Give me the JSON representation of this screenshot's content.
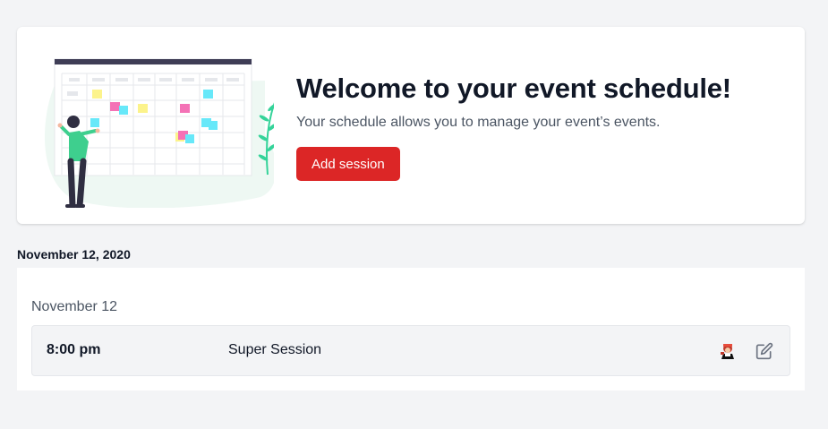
{
  "hero": {
    "title": "Welcome to your event schedule!",
    "subtitle": "Your schedule allows you to manage your event’s events.",
    "add_session_label": "Add session",
    "illustration_icon": "calendar-illustration"
  },
  "schedule": {
    "date_heading": "November 12, 2020",
    "days": [
      {
        "label": "November 12",
        "sessions": [
          {
            "time": "8:00 pm",
            "name": "Super Session",
            "speaker_icon": "speaker-avatar-icon",
            "action_icon": "edit-icon"
          }
        ]
      }
    ]
  },
  "colors": {
    "accent": "#dc2626",
    "background": "#f3f4f6",
    "card": "#ffffff"
  }
}
